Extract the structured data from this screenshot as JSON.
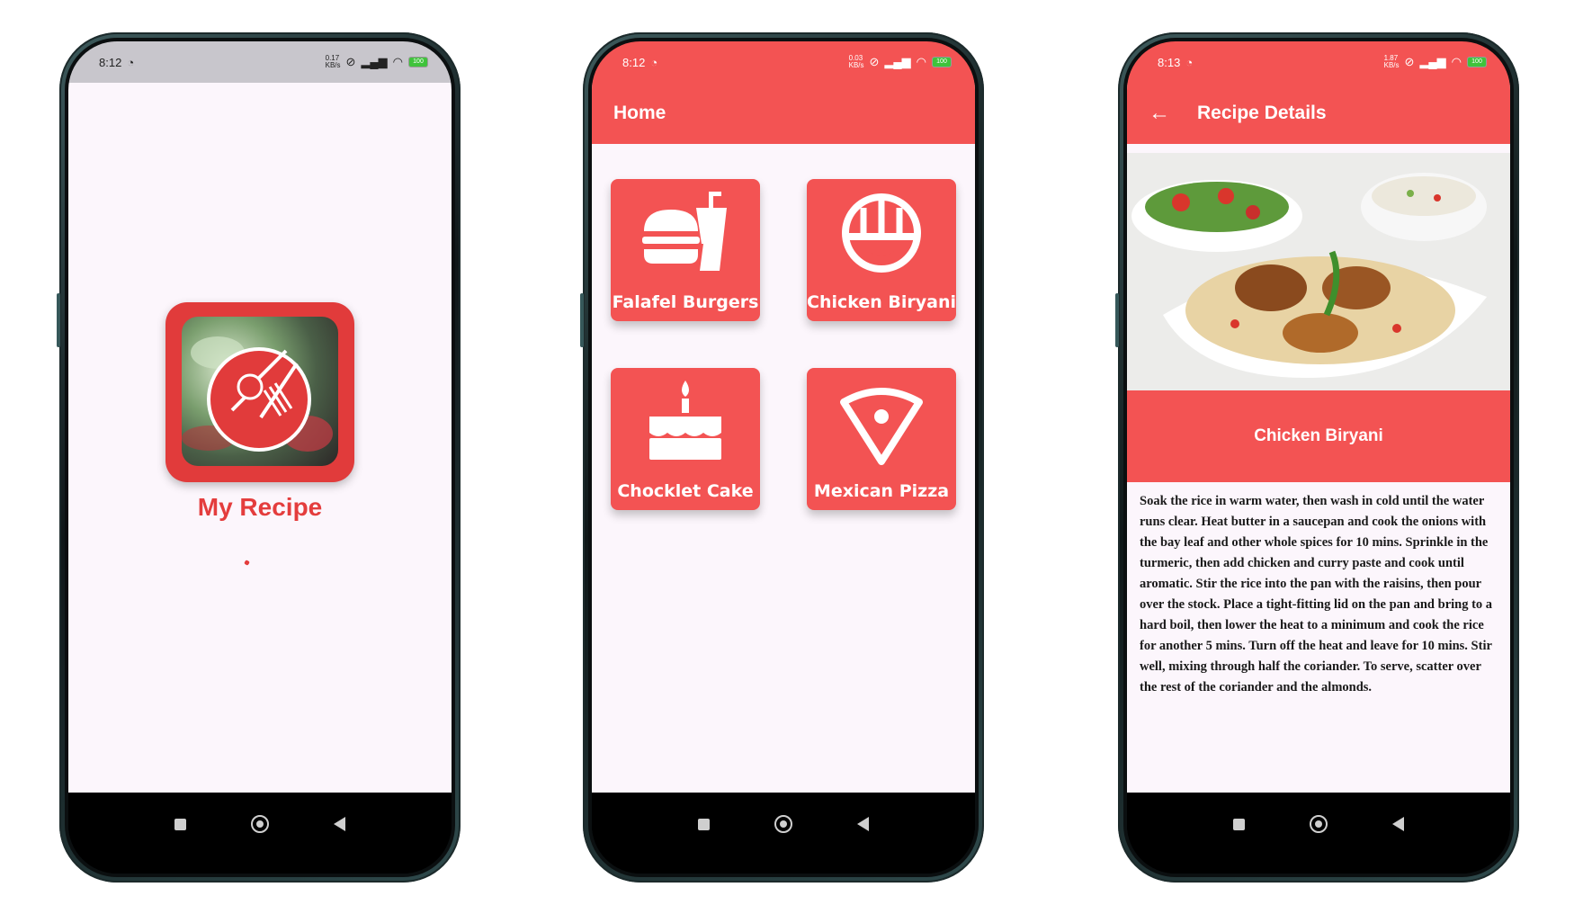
{
  "status": {
    "phone1": {
      "time": "8:12",
      "speed_top": "0.17",
      "speed_bottom": "KB/s",
      "battery": "100"
    },
    "phone2": {
      "time": "8:12",
      "speed_top": "0.03",
      "speed_bottom": "KB/s",
      "battery": "100"
    },
    "phone3": {
      "time": "8:13",
      "speed_top": "1.87",
      "speed_bottom": "KB/s",
      "battery": "100"
    }
  },
  "splash": {
    "title": "My Recipe"
  },
  "home": {
    "title": "Home",
    "tiles": [
      {
        "label": "Falafel Burgers",
        "icon": "burger-drink-icon"
      },
      {
        "label": "Chicken Biryani",
        "icon": "rice-bowl-icon"
      },
      {
        "label": "Chocklet Cake",
        "icon": "cake-icon"
      },
      {
        "label": "Mexican Pizza",
        "icon": "pizza-slice-icon"
      }
    ]
  },
  "detail": {
    "title": "Recipe Details",
    "dish_name": "Chicken Biryani",
    "description": "Soak the rice in warm water, then wash in cold until the water runs clear. Heat butter in a saucepan and cook the onions with the bay leaf and other whole spices for 10 mins. Sprinkle in the turmeric, then add chicken and curry paste and cook until aromatic. Stir the rice into the pan with the raisins, then pour over the stock. Place a tight-fitting lid on the pan and bring to a hard boil, then lower the heat to a minimum and cook the rice for another 5 mins. Turn off the heat and leave for 10 mins. Stir well, mixing through half the coriander. To serve, scatter over the rest of the coriander and the almonds."
  },
  "colors": {
    "primary": "#f35353",
    "background": "#fcf6fc",
    "accent_text": "#e43d3d"
  }
}
